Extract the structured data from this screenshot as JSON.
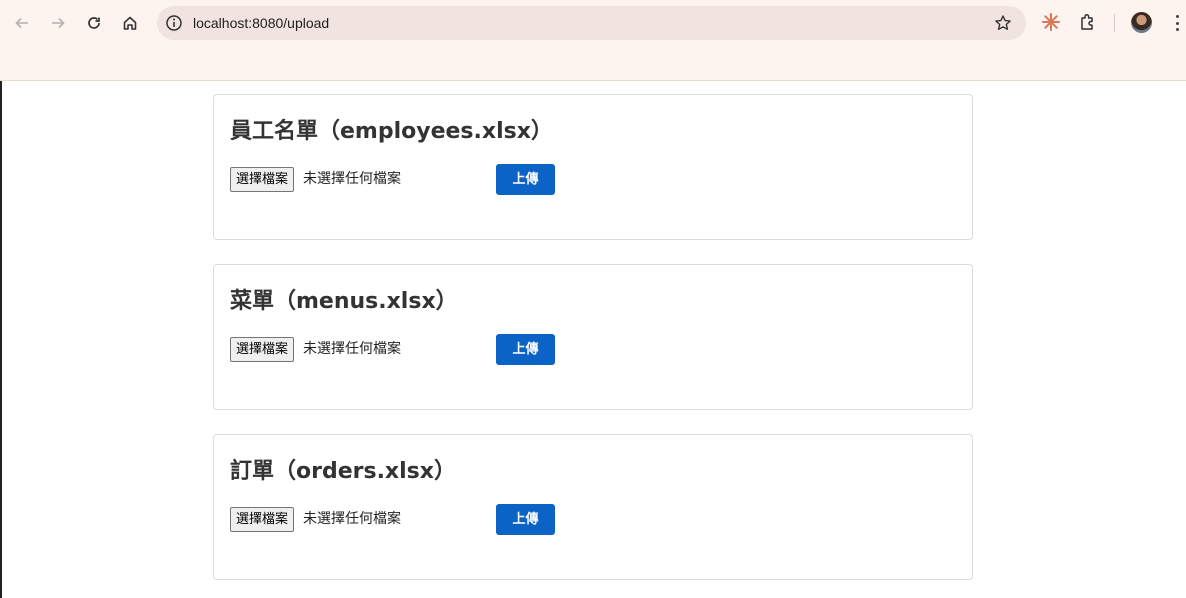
{
  "browser": {
    "url": "localhost:8080/upload",
    "icons": [
      "back-arrow-icon",
      "forward-arrow-icon",
      "reload-icon",
      "home-icon",
      "site-info-icon",
      "bookmark-star-icon",
      "claude-extension-icon",
      "extensions-puzzle-icon",
      "profile-avatar",
      "menu-kebab-icon"
    ]
  },
  "upload_sections": [
    {
      "title": "員工名單（employees.xlsx）",
      "choose_label": "選擇檔案",
      "file_status": "未選擇任何檔案",
      "upload_label": "上傳"
    },
    {
      "title": "菜單（menus.xlsx）",
      "choose_label": "選擇檔案",
      "file_status": "未選擇任何檔案",
      "upload_label": "上傳"
    },
    {
      "title": "訂單（orders.xlsx）",
      "choose_label": "選擇檔案",
      "file_status": "未選擇任何檔案",
      "upload_label": "上傳"
    }
  ],
  "colors": {
    "chrome_bg": "#fdf3ef",
    "omnibox_bg": "#f1e3df",
    "upload_button": "#0b63c5",
    "card_border": "#dcdcdc"
  }
}
